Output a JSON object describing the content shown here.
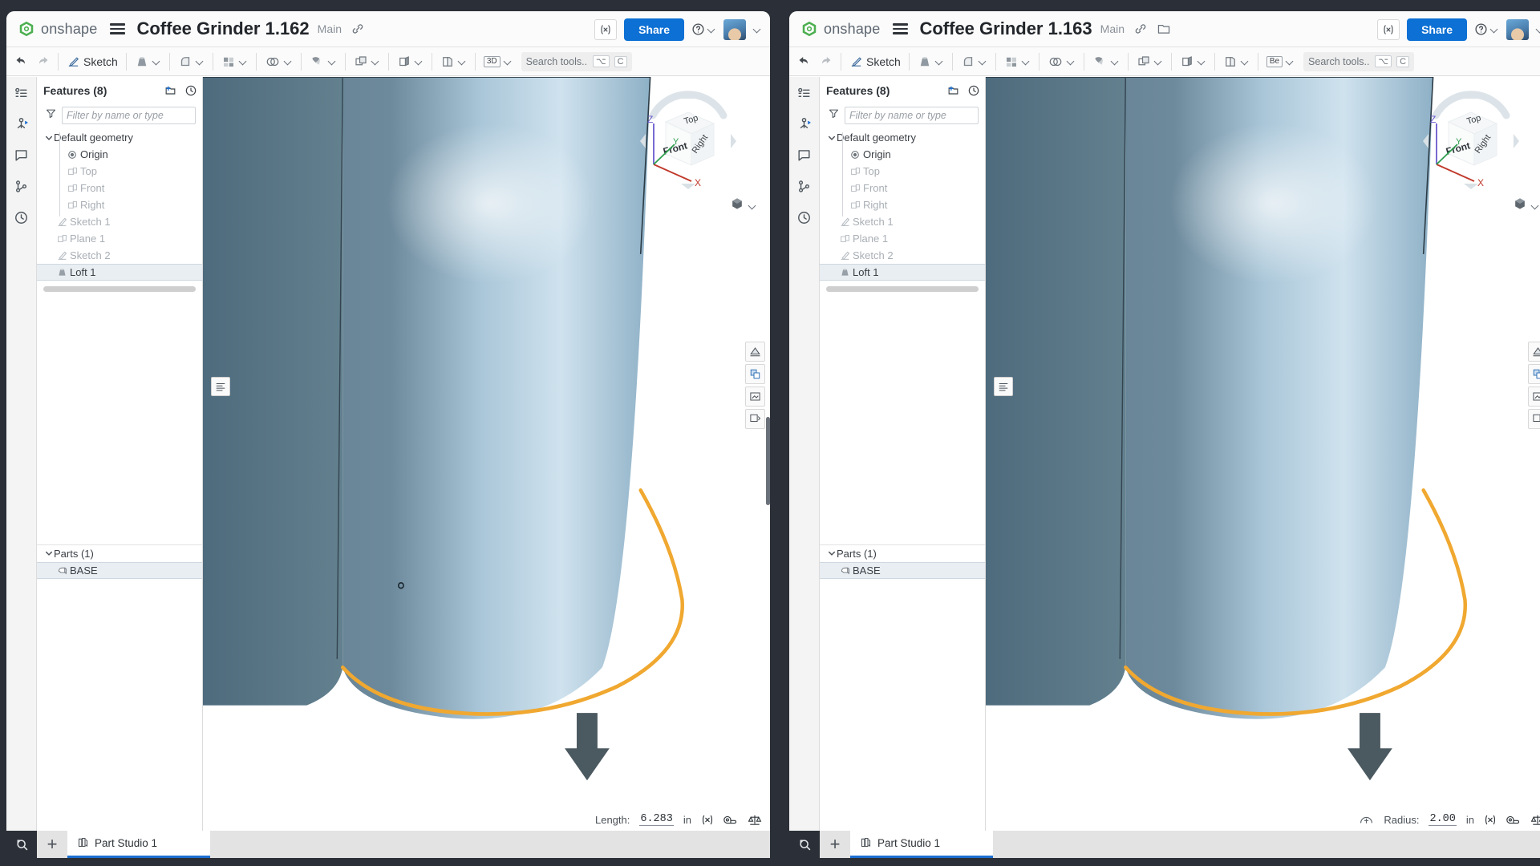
{
  "app": {
    "brand": "onshape",
    "accent_blue": "#0c70d4",
    "selection_bg": "#e9eef3",
    "highlight_orange": "#f0a830"
  },
  "panels": [
    {
      "id": "left",
      "header": {
        "brand": "onshape",
        "document_title": "Coffee Grinder 1.162",
        "branch": "Main",
        "link_icon": "link-icon",
        "share_label": "Share",
        "help_icon": "help-icon",
        "avatar_icon": "user-avatar"
      },
      "toolbar": {
        "undo_icon": "undo-icon",
        "redo_icon": "redo-icon",
        "sketch_label": "Sketch",
        "sketch_icon": "sketch-pencil-icon",
        "tools": [
          {
            "name": "extrude-tool",
            "icon": "extrude-icon"
          },
          {
            "name": "fillet-tool",
            "icon": "fillet-icon"
          },
          {
            "name": "pattern-tool",
            "icon": "pattern-icon"
          },
          {
            "name": "boolean-tool",
            "icon": "boolean-icon"
          },
          {
            "name": "draft-tool",
            "icon": "draft-icon"
          },
          {
            "name": "plane-tool",
            "icon": "plane-icon"
          },
          {
            "name": "transform-tool",
            "icon": "transform-icon"
          },
          {
            "name": "sheet-metal-tool",
            "icon": "sheet-metal-icon"
          }
        ],
        "mode_badge": "3D",
        "search_placeholder": "Search tools...",
        "search_shortcut_1": "⌥",
        "search_shortcut_2": "C"
      },
      "rail": [
        {
          "name": "feature-list-icon"
        },
        {
          "name": "assembly-icon"
        },
        {
          "name": "comments-icon"
        },
        {
          "name": "versions-icon"
        },
        {
          "name": "history-icon"
        }
      ],
      "tree": {
        "title": "Features (8)",
        "add_feature_icon": "add-feature-icon",
        "history-icon": "rollback-history-icon",
        "filter_icon": "filter-funnel-icon",
        "filter_placeholder": "Filter by name or type",
        "nodes": [
          {
            "label": "Default geometry",
            "icon": "folder-icon",
            "level": 0,
            "caret": "expanded",
            "dim": false,
            "selected": false
          },
          {
            "label": "Origin",
            "icon": "origin-icon",
            "level": 2,
            "caret": "",
            "dim": false,
            "selected": false
          },
          {
            "label": "Top",
            "icon": "plane-icon",
            "level": 2,
            "caret": "",
            "dim": true,
            "selected": false
          },
          {
            "label": "Front",
            "icon": "plane-icon",
            "level": 2,
            "caret": "",
            "dim": true,
            "selected": false
          },
          {
            "label": "Right",
            "icon": "plane-icon",
            "level": 2,
            "caret": "",
            "dim": true,
            "selected": false
          },
          {
            "label": "Sketch 1",
            "icon": "sketch-icon",
            "level": 1,
            "caret": "",
            "dim": true,
            "selected": false
          },
          {
            "label": "Plane 1",
            "icon": "plane-icon",
            "level": 1,
            "caret": "",
            "dim": true,
            "selected": false
          },
          {
            "label": "Sketch 2",
            "icon": "sketch-icon",
            "level": 1,
            "caret": "",
            "dim": true,
            "selected": false
          },
          {
            "label": "Loft 1",
            "icon": "loft-icon",
            "level": 1,
            "caret": "",
            "dim": false,
            "selected": true
          }
        ],
        "parts_title": "Parts (1)",
        "parts": [
          {
            "label": "BASE",
            "icon": "part-icon"
          }
        ]
      },
      "viewport": {
        "view_cube": {
          "top": "Top",
          "front": "Front",
          "right": "Right",
          "axis_x": "X",
          "axis_y": "Y",
          "axis_z": "Z"
        },
        "view_mode_icon": "shaded-cube-icon",
        "list_button_icon": "feature-list-icon",
        "right_tools": [
          {
            "name": "section-view-icon"
          },
          {
            "name": "display-state-icon"
          },
          {
            "name": "render-icon"
          },
          {
            "name": "explode-icon"
          }
        ],
        "cursor_marker": "selection-dot"
      },
      "status": {
        "prefix_icon": "",
        "label": "Length:",
        "value": "6.283",
        "unit": "in",
        "variable_icon": "variable-x-icon",
        "measure_icon": "tape-measure-icon",
        "mass_icon": "mass-properties-icon"
      },
      "tabbar": {
        "zoom_icon": "zoom-window-icon",
        "add_tab_label": "+",
        "tab_icon": "part-studio-icon",
        "tab_label": "Part Studio 1"
      }
    },
    {
      "id": "right",
      "header": {
        "brand": "onshape",
        "document_title": "Coffee Grinder 1.163",
        "branch": "Main",
        "link_icon": "link-icon",
        "share_label": "Share",
        "help_icon": "help-icon",
        "avatar_icon": "user-avatar"
      },
      "toolbar": {
        "undo_icon": "undo-icon",
        "redo_icon": "redo-icon",
        "sketch_label": "Sketch",
        "sketch_icon": "sketch-pencil-icon",
        "tools": [
          {
            "name": "extrude-tool",
            "icon": "extrude-icon"
          },
          {
            "name": "fillet-tool",
            "icon": "fillet-icon"
          },
          {
            "name": "pattern-tool",
            "icon": "pattern-icon"
          },
          {
            "name": "boolean-tool",
            "icon": "boolean-icon"
          },
          {
            "name": "draft-tool",
            "icon": "draft-icon"
          },
          {
            "name": "plane-tool",
            "icon": "plane-icon"
          },
          {
            "name": "transform-tool",
            "icon": "transform-icon"
          },
          {
            "name": "sheet-metal-tool",
            "icon": "sheet-metal-icon"
          }
        ],
        "mode_badge": "Be",
        "search_placeholder": "Search tools...",
        "search_shortcut_1": "⌥",
        "search_shortcut_2": "C"
      },
      "rail": [
        {
          "name": "feature-list-icon"
        },
        {
          "name": "assembly-icon"
        },
        {
          "name": "comments-icon"
        },
        {
          "name": "versions-icon"
        },
        {
          "name": "history-icon"
        }
      ],
      "tree": {
        "title": "Features (8)",
        "add_feature_icon": "add-feature-icon",
        "history-icon": "rollback-history-icon",
        "filter_icon": "filter-funnel-icon",
        "filter_placeholder": "Filter by name or type",
        "nodes": [
          {
            "label": "Default geometry",
            "icon": "folder-icon",
            "level": 0,
            "caret": "expanded",
            "dim": false,
            "selected": false
          },
          {
            "label": "Origin",
            "icon": "origin-icon",
            "level": 2,
            "caret": "",
            "dim": false,
            "selected": false
          },
          {
            "label": "Top",
            "icon": "plane-icon",
            "level": 2,
            "caret": "",
            "dim": true,
            "selected": false
          },
          {
            "label": "Front",
            "icon": "plane-icon",
            "level": 2,
            "caret": "",
            "dim": true,
            "selected": false
          },
          {
            "label": "Right",
            "icon": "plane-icon",
            "level": 2,
            "caret": "",
            "dim": true,
            "selected": false
          },
          {
            "label": "Sketch 1",
            "icon": "sketch-icon",
            "level": 1,
            "caret": "",
            "dim": true,
            "selected": false
          },
          {
            "label": "Plane 1",
            "icon": "plane-icon",
            "level": 1,
            "caret": "",
            "dim": true,
            "selected": false
          },
          {
            "label": "Sketch 2",
            "icon": "sketch-icon",
            "level": 1,
            "caret": "",
            "dim": true,
            "selected": false
          },
          {
            "label": "Loft 1",
            "icon": "loft-icon",
            "level": 1,
            "caret": "",
            "dim": false,
            "selected": true
          }
        ],
        "parts_title": "Parts (1)",
        "parts": [
          {
            "label": "BASE",
            "icon": "part-icon"
          }
        ]
      },
      "viewport": {
        "view_cube": {
          "top": "Top",
          "front": "Front",
          "right": "Right",
          "axis_x": "X",
          "axis_y": "Y",
          "axis_z": "Z"
        },
        "view_mode_icon": "shaded-cube-icon",
        "list_button_icon": "feature-list-icon",
        "right_tools": [
          {
            "name": "section-view-icon"
          },
          {
            "name": "display-state-icon"
          },
          {
            "name": "render-icon"
          },
          {
            "name": "explode-icon"
          }
        ],
        "cursor_marker": ""
      },
      "status": {
        "prefix_icon": "radius-arc-icon",
        "label": "Radius:",
        "value": "2.00",
        "unit": "in",
        "variable_icon": "variable-x-icon",
        "measure_icon": "tape-measure-icon",
        "mass_icon": "mass-properties-icon"
      },
      "tabbar": {
        "zoom_icon": "zoom-window-icon",
        "add_tab_label": "+",
        "tab_icon": "part-studio-icon",
        "tab_label": "Part Studio 1"
      }
    }
  ]
}
